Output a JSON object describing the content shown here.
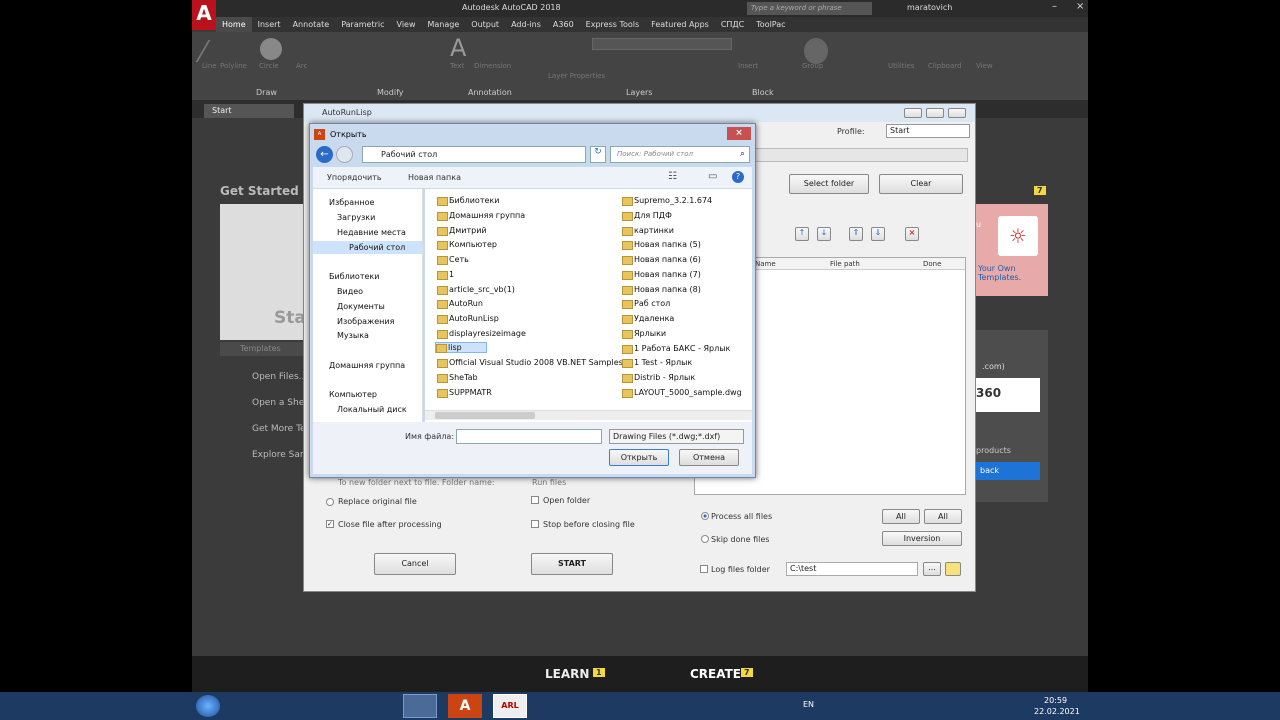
{
  "acad": {
    "title": "Autodesk AutoCAD 2018",
    "search_placeholder": "Type a keyword or phrase",
    "user": "maratovich",
    "menus": [
      "Home",
      "Insert",
      "Annotate",
      "Parametric",
      "View",
      "Manage",
      "Output",
      "Add-ins",
      "A360",
      "Express Tools",
      "Featured Apps",
      "СПДС",
      "ToolPac"
    ],
    "ribbon": {
      "draw_tools": [
        "Line",
        "Polyline",
        "Circle",
        "Arc"
      ],
      "text_tools": [
        "Text",
        "Dimension"
      ],
      "layer_tool": "Layer Properties",
      "right_tools": [
        "Insert",
        "Group",
        "Utilities",
        "Clipboard",
        "View"
      ],
      "panels": [
        "Draw",
        "Modify",
        "Annotation",
        "Layers",
        "Block"
      ]
    },
    "start_tab": "Start",
    "get_started": "Get Started",
    "start_label": "Sta",
    "templates": "Templates",
    "links": [
      "Open Files...",
      "Open a Shee",
      "Get More Te",
      "Explore Sam"
    ],
    "right_card": {
      "text": "Your Own Templates.",
      "prefix": "u",
      "badge": "7"
    },
    "a360": {
      "text": "360",
      "suffix": ".com)",
      "products": "products",
      "back_btn": "back"
    },
    "bottom": {
      "learn": "LEARN",
      "learn_badge": "1",
      "create": "CREATE",
      "create_badge": "7"
    }
  },
  "arl": {
    "title": "AutoRunLisp",
    "profile_label": "Profile:",
    "profile_value": "Start",
    "select_folder": "Select folder",
    "clear": "Clear",
    "table_cols": [
      "Name",
      "File path",
      "Done"
    ],
    "options": {
      "new_folder": "To new folder next to file. Folder name:",
      "run_files": "Run files",
      "replace": "Replace original file",
      "open_folder": "Open folder",
      "close_after": "Close file after processing",
      "stop_before": "Stop before closing file"
    },
    "cancel": "Cancel",
    "start": "START",
    "process_all": "Process all files",
    "skip_done": "Skip done files",
    "all1": "All",
    "all2": "All",
    "inversion": "Inversion",
    "log_label": "Log files folder",
    "log_value": "C:\\test",
    "browse": "..."
  },
  "open_dialog": {
    "title": "Открыть",
    "address": "Рабочий стол",
    "search_placeholder": "Поиск: Рабочий стол",
    "organize": "Упорядочить",
    "new_folder": "Новая папка",
    "nav": [
      {
        "label": "Избранное",
        "indent": 0
      },
      {
        "label": "Загрузки",
        "indent": 1
      },
      {
        "label": "Недавние места",
        "indent": 1
      },
      {
        "label": "Рабочий стол",
        "indent": 1
      },
      {
        "label": "Библиотеки",
        "indent": 0
      },
      {
        "label": "Видео",
        "indent": 1
      },
      {
        "label": "Документы",
        "indent": 1
      },
      {
        "label": "Изображения",
        "indent": 1
      },
      {
        "label": "Музыка",
        "indent": 1
      },
      {
        "label": "Домашняя группа",
        "indent": 0
      },
      {
        "label": "Компьютер",
        "indent": 0
      },
      {
        "label": "Локальный диск",
        "indent": 1
      }
    ],
    "files_col1": [
      "Библиотеки",
      "Домашняя группа",
      "Дмитрий",
      "Компьютер",
      "Сеть",
      "1",
      "article_src_vb(1)",
      "AutoRun",
      "AutoRunLisp",
      "displayresizeimage",
      "lisp",
      "Official Visual Studio 2008 VB.NET Samples",
      "SheTab",
      "SUPPMATR"
    ],
    "files_col2": [
      "Supremo_3.2.1.674",
      "Для ПДФ",
      "картинки",
      "Новая папка (5)",
      "Новая папка (6)",
      "Новая папка (7)",
      "Новая папка (8)",
      "Раб стол",
      "Удаленка",
      "Ярлыки",
      "1   Работа БАКС - Ярлык",
      "1  Test - Ярлык",
      "Distrib - Ярлык",
      "LAYOUT_5000_sample.dwg"
    ],
    "selected": "lisp",
    "filename_label": "Имя файла:",
    "filename_value": "",
    "filetype": "Drawing Files (*.dwg;*.dxf)",
    "open_btn": "Открыть",
    "cancel_btn": "Отмена"
  },
  "taskbar": {
    "lang": "EN",
    "time": "20:59",
    "date": "22.02.2021",
    "arl_icon": "ARL"
  }
}
